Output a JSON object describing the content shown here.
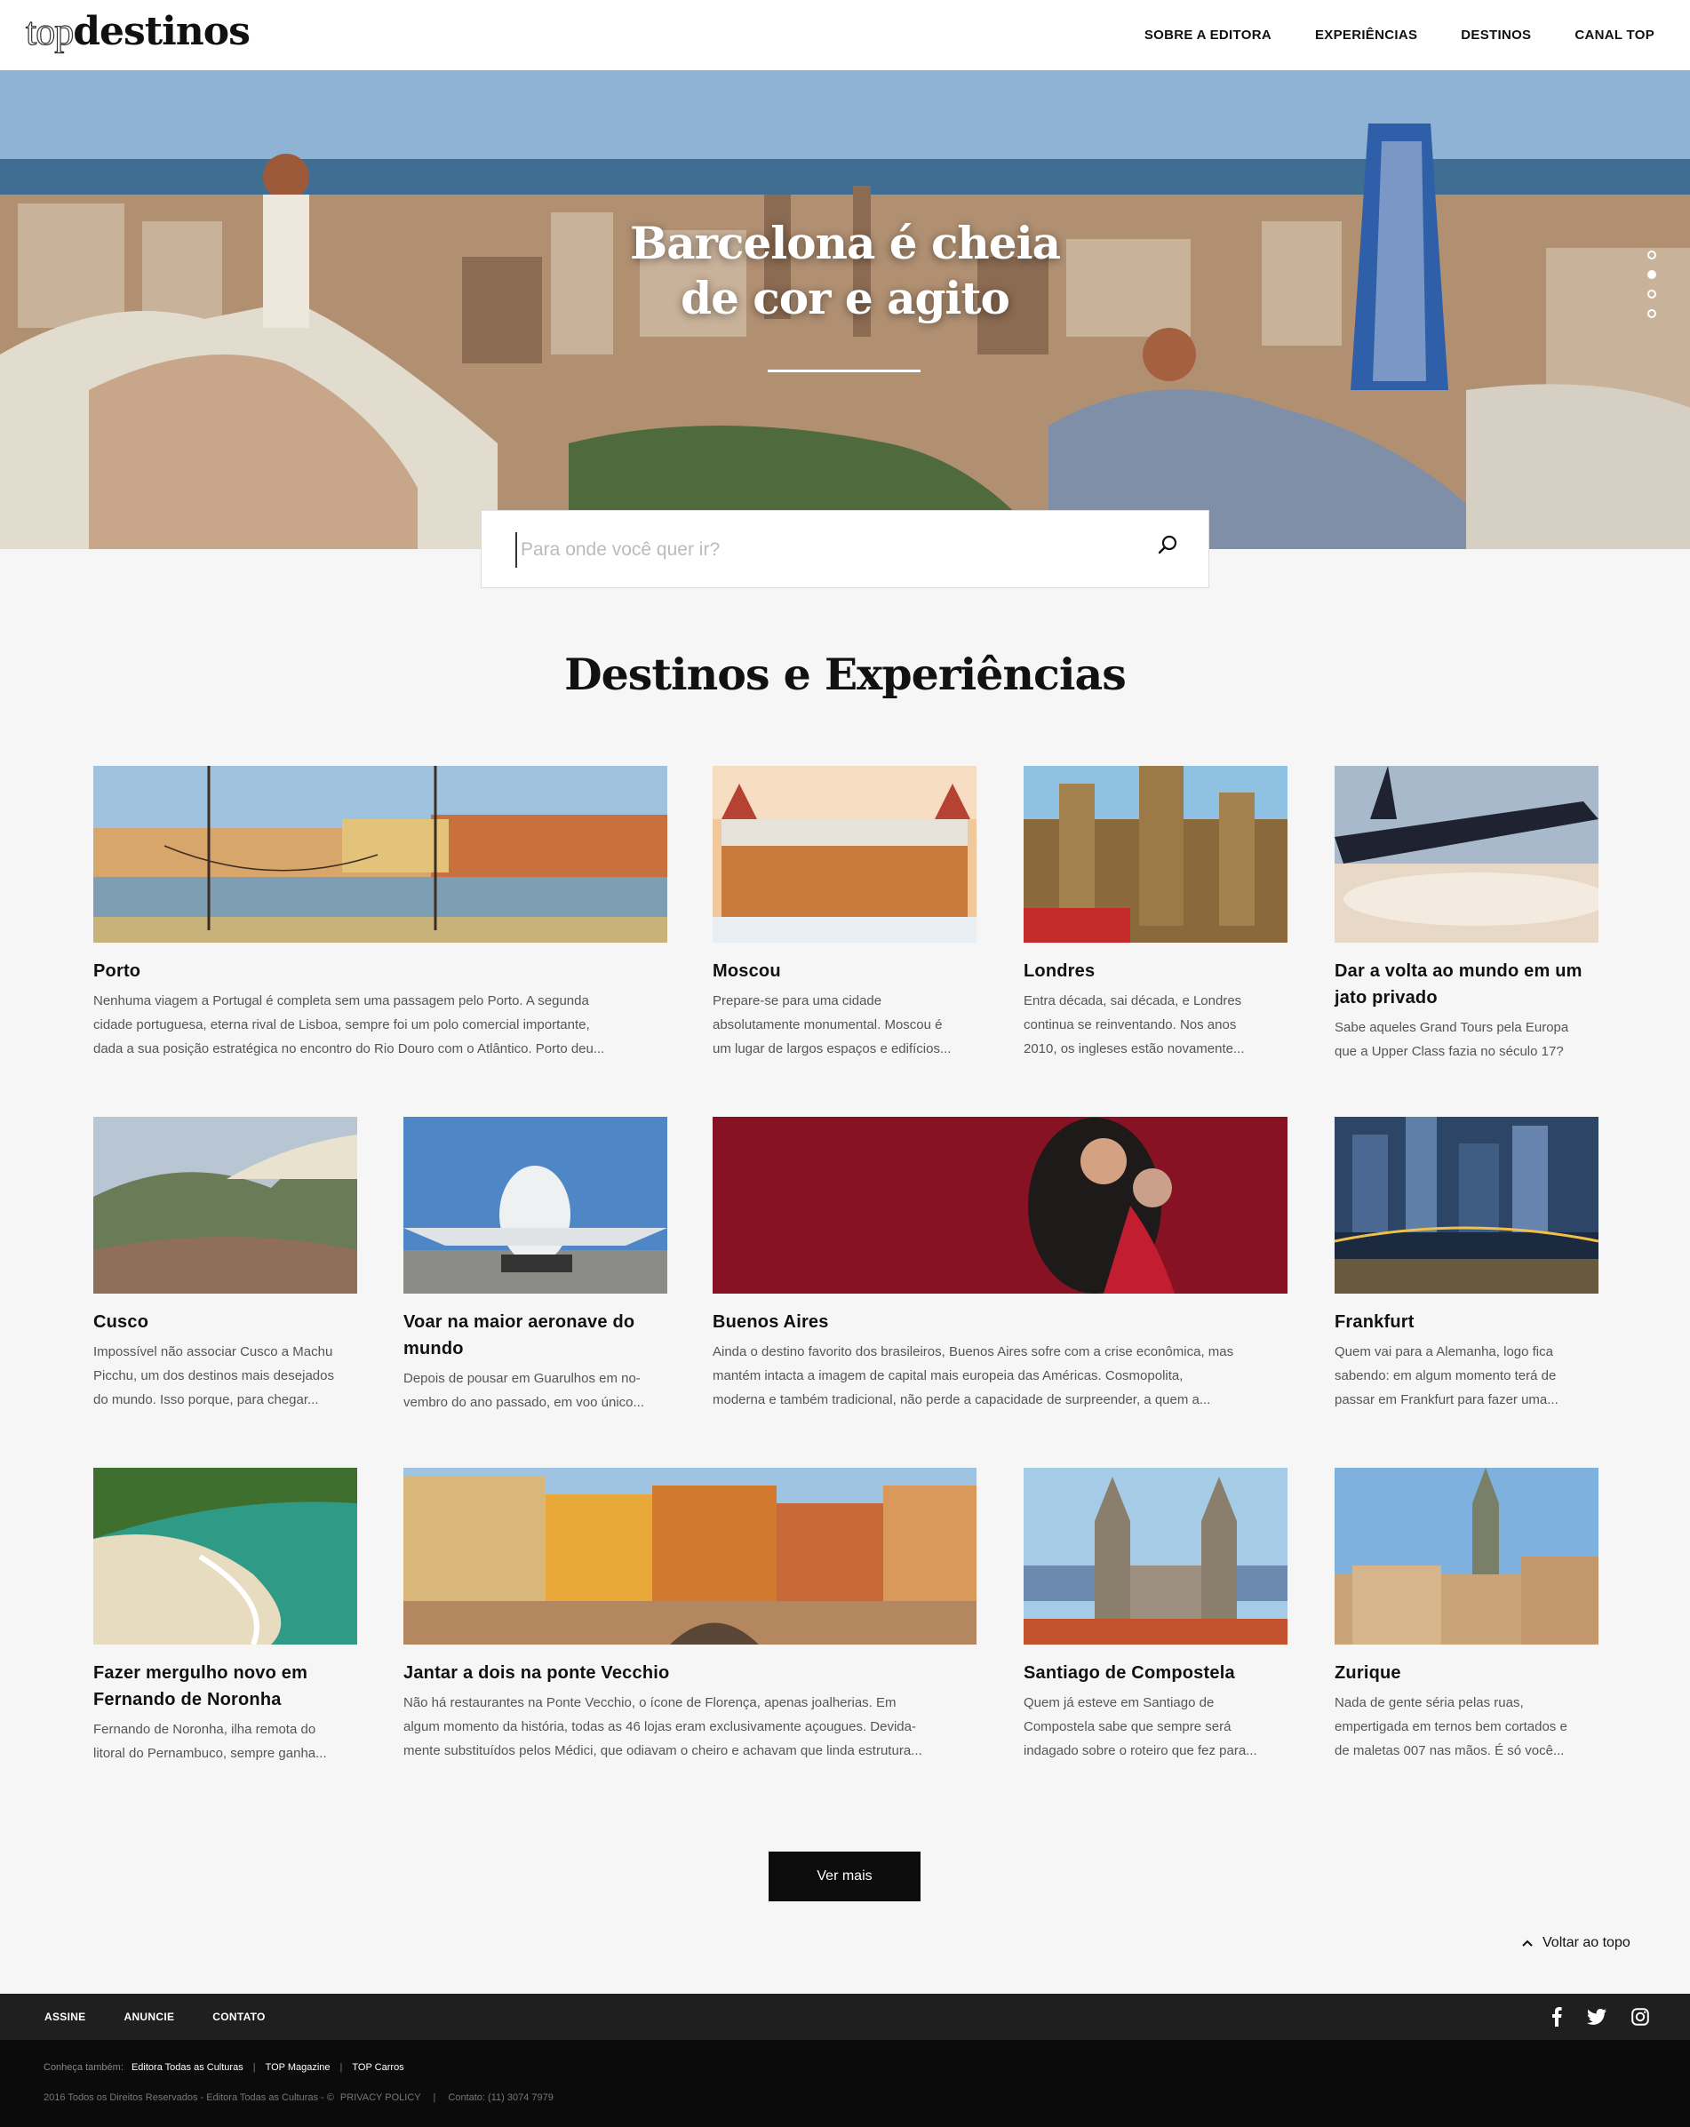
{
  "brand": {
    "logo_top": "top",
    "logo_destinos": "destinos"
  },
  "nav": [
    "SOBRE A EDITORA",
    "EXPERIÊNCIAS",
    "DESTINOS",
    "CANAL TOP"
  ],
  "hero": {
    "title_line1": "Barcelona é cheia",
    "title_line2": "de cor e agito",
    "slides": 4,
    "active_slide": 2
  },
  "search": {
    "placeholder": "Para onde você quer ir?"
  },
  "section_title": "Destinos e Experiências",
  "cards": [
    {
      "title": "Porto",
      "desc": [
        "Nenhuma viagem a Portugal é completa sem uma passagem pelo Porto. A segunda",
        "cidade portuguesa, eterna rival de Lisboa, sempre foi um polo comercial importante,",
        "dada a sua posição estratégica no encontro do Rio Douro com o Atlântico. Porto deu..."
      ]
    },
    {
      "title": "Moscou",
      "desc": [
        "Prepare-se para uma cidade",
        "absolutamente monumental. Moscou é",
        "um lugar de largos espaços e edifícios..."
      ]
    },
    {
      "title": "Londres",
      "desc": [
        "Entra década, sai década, e Londres",
        "continua se reinventando. Nos anos",
        "2010, os ingleses estão novamente..."
      ]
    },
    {
      "title": "Dar a volta ao mundo em um jato privado",
      "desc": [
        "Sabe aqueles Grand Tours pela Europa",
        "que a Upper Class fazia no século 17?"
      ]
    },
    {
      "title": "Cusco",
      "desc": [
        "Impossível não associar Cusco a Machu",
        "Picchu, um dos destinos mais desejados",
        "do mundo. Isso porque, para chegar..."
      ]
    },
    {
      "title": "Voar na maior aeronave do mundo",
      "desc": [
        "Depois de pousar em Guarulhos em no-",
        "vembro do ano passado, em voo único..."
      ]
    },
    {
      "title": "Buenos Aires",
      "desc": [
        "Ainda o destino favorito dos brasileiros, Buenos Aires sofre com a crise econômica, mas",
        "mantém intacta a imagem de capital mais europeia das Américas. Cosmopolita,",
        "moderna e também tradicional, não perde a capacidade de surpreender, a quem a..."
      ]
    },
    {
      "title": "Frankfurt",
      "desc": [
        "Quem vai para a Alemanha, logo fica",
        "sabendo: em algum momento terá de",
        "passar em Frankfurt para fazer uma..."
      ]
    },
    {
      "title": "Fazer mergulho novo em Fernando de Noronha",
      "desc": [
        "Fernando de Noronha, ilha remota do",
        "litoral do Pernambuco, sempre ganha..."
      ]
    },
    {
      "title": "Jantar a dois na ponte Vecchio",
      "desc": [
        "Não há restaurantes na Ponte Vecchio, o ícone de Florença, apenas joalherias. Em",
        "algum momento da história, todas as 46 lojas eram exclusivamente açougues. Devida-",
        "mente substituídos pelos Médici, que odiavam o cheiro e achavam que linda estrutura..."
      ]
    },
    {
      "title": "Santiago de Compostela",
      "desc": [
        "Quem já esteve em Santiago de",
        "Compostela sabe que sempre será",
        "indagado sobre o roteiro que fez para..."
      ]
    },
    {
      "title": "Zurique",
      "desc": [
        "Nada de gente séria pelas ruas,",
        "empertigada em ternos bem cortados e",
        "de maletas 007 nas mãos. É só você..."
      ]
    }
  ],
  "more_button": "Ver mais",
  "back_to_top": "Voltar ao topo",
  "footer": {
    "links": [
      "ASSINE",
      "ANUNCIE",
      "CONTATO"
    ],
    "social_icons": [
      "facebook-icon",
      "twitter-icon",
      "instagram-icon"
    ],
    "also_label": "Conheça também:",
    "also_links": [
      "Editora Todas as Culturas",
      "TOP Magazine",
      "TOP Carros"
    ],
    "copyright": "2016 Todos os Direitos Reservados - Editora Todas as Culturas - ©",
    "privacy": "PRIVACY POLICY",
    "contact": "Contato: (11) 3074 7979"
  }
}
